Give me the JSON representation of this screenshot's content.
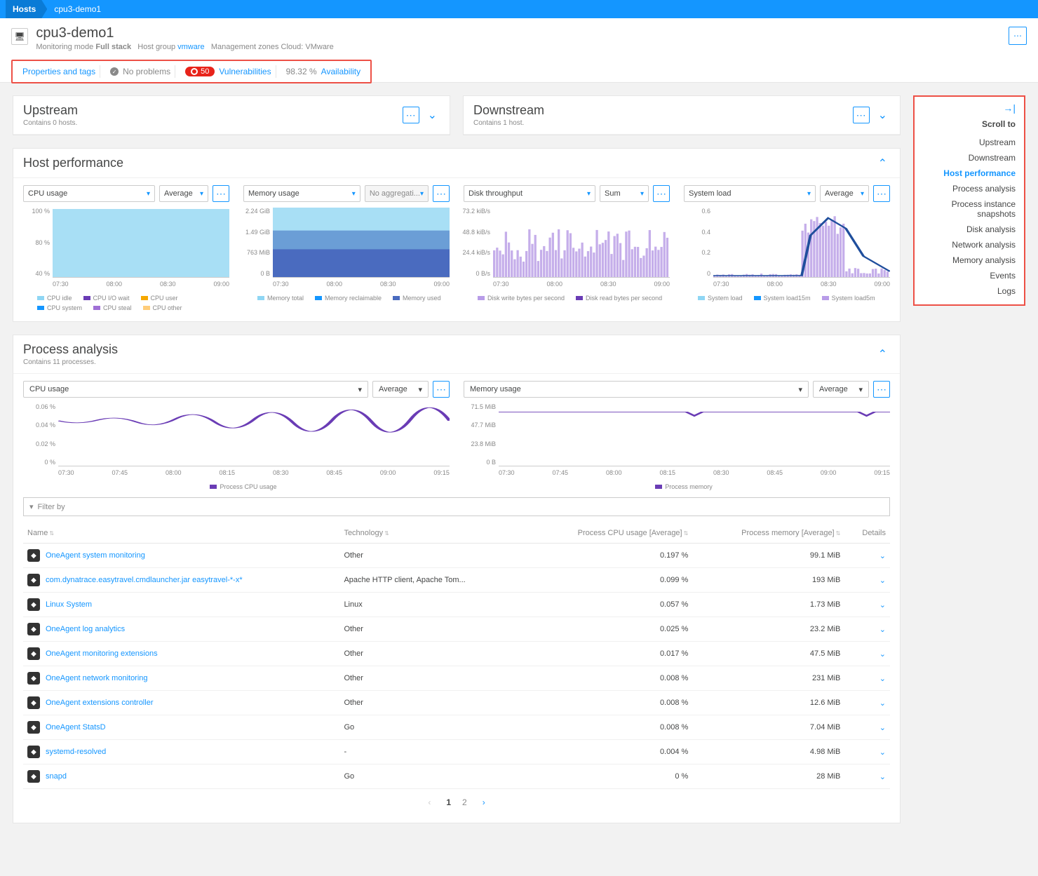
{
  "breadcrumb": {
    "root": "Hosts",
    "current": "cpu3-demo1"
  },
  "header": {
    "title": "cpu3-demo1",
    "meta_mode_label": "Monitoring mode",
    "meta_mode_value": "Full stack",
    "meta_hostgroup_label": "Host group",
    "meta_hostgroup_value": "vmware",
    "meta_zones_label": "Management zones",
    "meta_zones_value": "Cloud: VMware"
  },
  "tagbar": {
    "properties": "Properties and tags",
    "problems": "No problems",
    "vuln_count": "50",
    "vuln_label": "Vulnerabilities",
    "avail_pct": "98.32 %",
    "avail_label": "Availability"
  },
  "upstream": {
    "title": "Upstream",
    "sub": "Contains 0 hosts."
  },
  "downstream": {
    "title": "Downstream",
    "sub": "Contains 1 host."
  },
  "sidebar": {
    "title": "Scroll to",
    "items": [
      "Upstream",
      "Downstream",
      "Host performance",
      "Process analysis",
      "Process instance snapshots",
      "Disk analysis",
      "Network analysis",
      "Memory analysis",
      "Events",
      "Logs"
    ],
    "active": "Host performance"
  },
  "host_perf": {
    "title": "Host performance",
    "charts": [
      {
        "metric": "CPU usage",
        "agg": "Average",
        "agg_disabled": false,
        "ylabels": [
          "100 %",
          "80 %",
          "40 %"
        ],
        "xlabels": [
          "07:30",
          "08:00",
          "08:30",
          "09:00"
        ],
        "legend": [
          {
            "c": "#8fd6f4",
            "t": "CPU idle"
          },
          {
            "c": "#6a3cb5",
            "t": "CPU I/O wait"
          },
          {
            "c": "#f6a800",
            "t": "CPU user"
          },
          {
            "c": "#1496ff",
            "t": "CPU system"
          },
          {
            "c": "#a070d6",
            "t": "CPU steal"
          },
          {
            "c": "#ffcd7a",
            "t": "CPU other"
          }
        ]
      },
      {
        "metric": "Memory usage",
        "agg": "No aggregati...",
        "agg_disabled": true,
        "ylabels": [
          "2.24 GiB",
          "1.49 GiB",
          "763 MiB",
          "0 B"
        ],
        "xlabels": [
          "07:30",
          "08:00",
          "08:30",
          "09:00"
        ],
        "legend": [
          {
            "c": "#8fd6f4",
            "t": "Memory total"
          },
          {
            "c": "#1496ff",
            "t": "Memory reclaimable"
          },
          {
            "c": "#4a6bbf",
            "t": "Memory used"
          }
        ]
      },
      {
        "metric": "Disk throughput",
        "agg": "Sum",
        "agg_disabled": false,
        "ylabels": [
          "73.2 kiB/s",
          "48.8 kiB/s",
          "24.4 kiB/s",
          "0 B/s"
        ],
        "xlabels": [
          "07:30",
          "08:00",
          "08:30",
          "09:00"
        ],
        "legend": [
          {
            "c": "#b89ce8",
            "t": "Disk write bytes per second"
          },
          {
            "c": "#6a3cb5",
            "t": "Disk read bytes per second"
          }
        ]
      },
      {
        "metric": "System load",
        "agg": "Average",
        "agg_disabled": false,
        "ylabels": [
          "0.6",
          "0.4",
          "0.2",
          "0"
        ],
        "xlabels": [
          "07:30",
          "08:00",
          "08:30",
          "09:00"
        ],
        "legend": [
          {
            "c": "#8fd6f4",
            "t": "System load"
          },
          {
            "c": "#1496ff",
            "t": "System load15m"
          },
          {
            "c": "#b89ce8",
            "t": "System load5m"
          }
        ]
      }
    ]
  },
  "proc": {
    "title": "Process analysis",
    "sub": "Contains 11 processes.",
    "left": {
      "metric": "CPU usage",
      "agg": "Average",
      "ylabels": [
        "0.06 %",
        "0.04 %",
        "0.02 %",
        "0 %"
      ],
      "xlabels": [
        "07:30",
        "07:45",
        "08:00",
        "08:15",
        "08:30",
        "08:45",
        "09:00",
        "09:15"
      ],
      "legend": "Process CPU usage"
    },
    "right": {
      "metric": "Memory usage",
      "agg": "Average",
      "ylabels": [
        "71.5 MiB",
        "47.7 MiB",
        "23.8 MiB",
        "0 B"
      ],
      "xlabels": [
        "07:30",
        "07:45",
        "08:00",
        "08:15",
        "08:30",
        "08:45",
        "09:00",
        "09:15"
      ],
      "legend": "Process memory"
    },
    "filter_placeholder": "Filter by",
    "headers": {
      "name": "Name",
      "tech": "Technology",
      "cpu": "Process CPU usage [Average]",
      "mem": "Process memory [Average]",
      "details": "Details"
    },
    "rows": [
      {
        "name": "OneAgent system monitoring",
        "tech": "Other",
        "cpu": "0.197 %",
        "mem": "99.1 MiB"
      },
      {
        "name": "com.dynatrace.easytravel.cmdlauncher.jar easytravel-*-x*",
        "tech": "Apache HTTP client, Apache Tom...",
        "cpu": "0.099 %",
        "mem": "193 MiB"
      },
      {
        "name": "Linux System",
        "tech": "Linux",
        "cpu": "0.057 %",
        "mem": "1.73 MiB"
      },
      {
        "name": "OneAgent log analytics",
        "tech": "Other",
        "cpu": "0.025 %",
        "mem": "23.2 MiB"
      },
      {
        "name": "OneAgent monitoring extensions",
        "tech": "Other",
        "cpu": "0.017 %",
        "mem": "47.5 MiB"
      },
      {
        "name": "OneAgent network monitoring",
        "tech": "Other",
        "cpu": "0.008 %",
        "mem": "231 MiB"
      },
      {
        "name": "OneAgent extensions controller",
        "tech": "Other",
        "cpu": "0.008 %",
        "mem": "12.6 MiB"
      },
      {
        "name": "OneAgent StatsD",
        "tech": "Go",
        "cpu": "0.008 %",
        "mem": "7.04 MiB"
      },
      {
        "name": "systemd-resolved",
        "tech": "-",
        "cpu": "0.004 %",
        "mem": "4.98 MiB"
      },
      {
        "name": "snapd",
        "tech": "Go",
        "cpu": "0 %",
        "mem": "28 MiB"
      }
    ],
    "pages": [
      "1",
      "2"
    ]
  },
  "chart_data": [
    {
      "type": "area",
      "title": "CPU usage",
      "x": [
        "07:30",
        "08:00",
        "08:30",
        "09:00"
      ],
      "ylim": [
        0,
        100
      ],
      "series": [
        {
          "name": "CPU idle",
          "values": [
            98,
            98,
            98,
            98
          ]
        }
      ]
    },
    {
      "type": "area",
      "title": "Memory usage",
      "x": [
        "07:30",
        "08:00",
        "08:30",
        "09:00"
      ],
      "ylim": [
        0,
        2.24
      ],
      "series": [
        {
          "name": "Memory total",
          "values": [
            2.24,
            2.24,
            2.24,
            2.24
          ]
        },
        {
          "name": "Memory reclaimable",
          "values": [
            1.5,
            1.5,
            1.5,
            1.5
          ]
        },
        {
          "name": "Memory used",
          "values": [
            0.9,
            0.9,
            0.9,
            0.9
          ]
        }
      ]
    },
    {
      "type": "bar",
      "title": "Disk throughput",
      "x": [
        "07:30",
        "08:00",
        "08:30",
        "09:00"
      ],
      "ylim": [
        0,
        73.2
      ],
      "series": [
        {
          "name": "Disk write bytes per second",
          "values": [
            50,
            45,
            55,
            40
          ]
        }
      ]
    },
    {
      "type": "line",
      "title": "System load",
      "x": [
        "07:30",
        "08:00",
        "08:30",
        "09:00"
      ],
      "ylim": [
        0,
        0.6
      ],
      "series": [
        {
          "name": "System load",
          "values": [
            0.02,
            0.02,
            0.55,
            0.05
          ]
        },
        {
          "name": "System load15m",
          "values": [
            0.02,
            0.02,
            0.5,
            0.1
          ]
        }
      ]
    },
    {
      "type": "line",
      "title": "Process CPU usage",
      "x": [
        "07:30",
        "07:45",
        "08:00",
        "08:15",
        "08:30",
        "08:45",
        "09:00",
        "09:15"
      ],
      "ylim": [
        0,
        0.06
      ],
      "series": [
        {
          "name": "Process CPU usage",
          "values": [
            0.042,
            0.045,
            0.041,
            0.046,
            0.044,
            0.043,
            0.045,
            0.044
          ]
        }
      ]
    },
    {
      "type": "line",
      "title": "Process memory",
      "x": [
        "07:30",
        "07:45",
        "08:00",
        "08:15",
        "08:30",
        "08:45",
        "09:00",
        "09:15"
      ],
      "ylim": [
        0,
        71.5
      ],
      "series": [
        {
          "name": "Process memory",
          "values": [
            62,
            62,
            62,
            62,
            62,
            62,
            62,
            62
          ]
        }
      ]
    }
  ]
}
